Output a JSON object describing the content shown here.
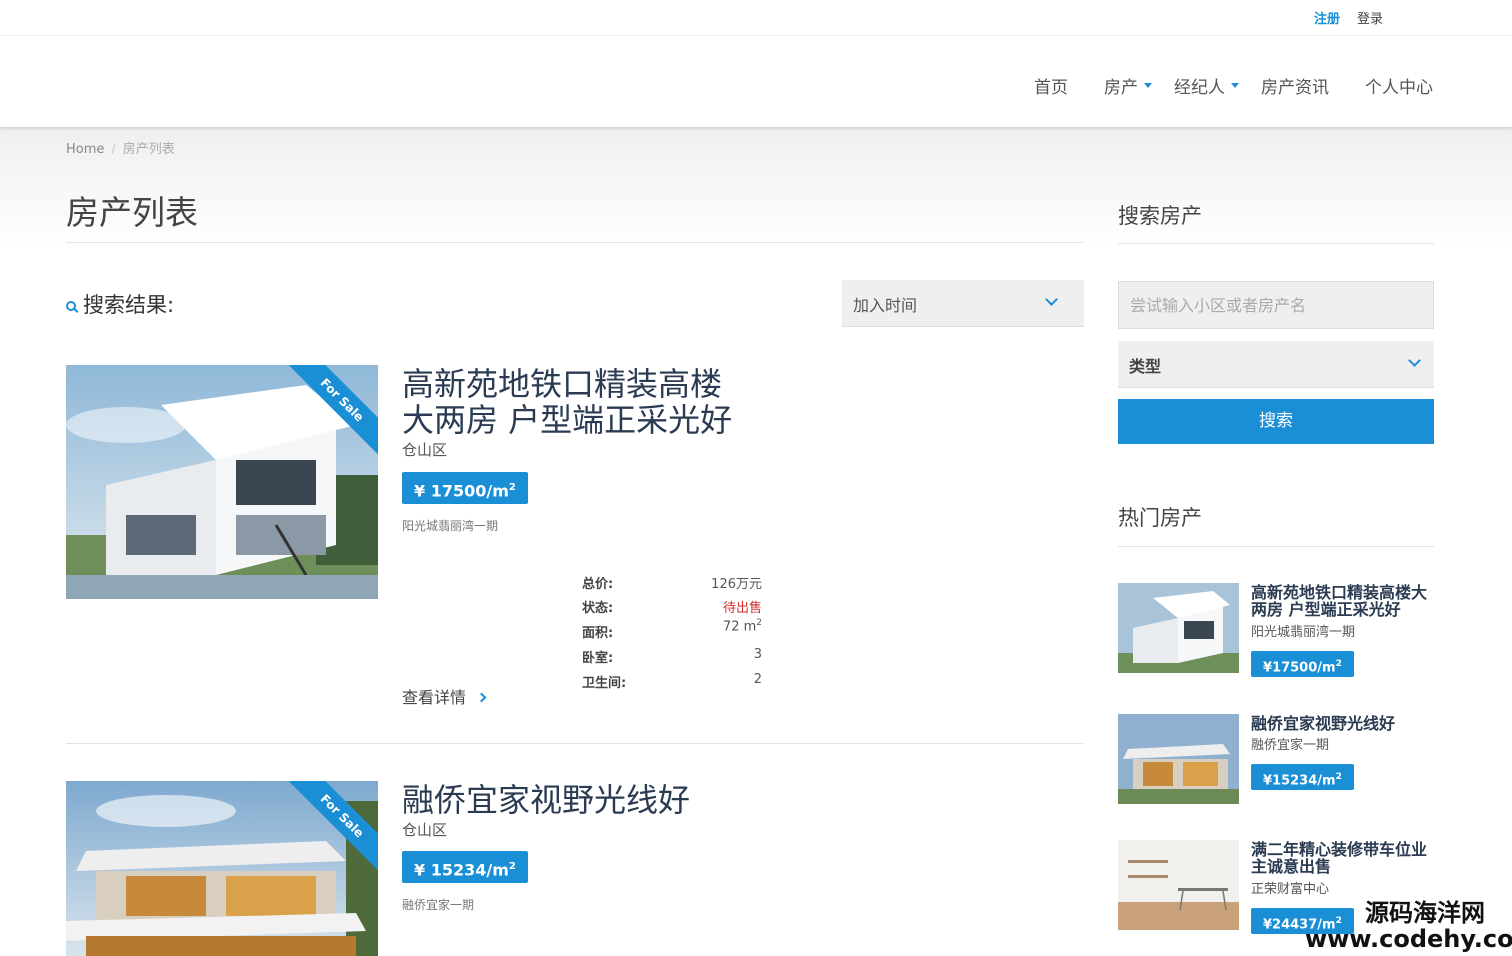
{
  "topbar": {
    "register": "注册",
    "login": "登录"
  },
  "nav": {
    "items": [
      {
        "label": "首页"
      },
      {
        "label": "房产"
      },
      {
        "label": "经纪人"
      },
      {
        "label": "房产资讯"
      },
      {
        "label": "个人中心"
      }
    ]
  },
  "breadcrumb": {
    "home": "Home",
    "current": "房产列表"
  },
  "page": {
    "title": "房产列表"
  },
  "results": {
    "heading": "搜索结果:",
    "sort_label": "加入时间"
  },
  "listings": [
    {
      "ribbon": "For Sale",
      "title_line1": "高新苑地铁口精装高楼",
      "title_line2": "大两房 户型端正采光好",
      "area": "仓山区",
      "price": "¥ 17500/m",
      "price_sup": "2",
      "community": "阳光城翡丽湾一期",
      "specs": [
        {
          "k": "总价:",
          "v": "126万元"
        },
        {
          "k": "状态:",
          "v": "待出售"
        },
        {
          "k": "面积:",
          "v": "72 m",
          "sup": "2"
        },
        {
          "k": "卧室:",
          "v": "3"
        },
        {
          "k": "卫生间:",
          "v": "2"
        }
      ],
      "more": "查看详情"
    },
    {
      "ribbon": "For Sale",
      "title_line1": "融侨宜家视野光线好",
      "area": "仓山区",
      "price": "¥ 15234/m",
      "price_sup": "2",
      "community": "融侨宜家一期"
    }
  ],
  "sidebar": {
    "search_title": "搜索房产",
    "search_placeholder": "尝试输入小区或者房产名",
    "type_label": "类型",
    "search_button": "搜索",
    "hot_title": "热门房产",
    "hot": [
      {
        "title": "高新苑地铁口精装高楼大两房 户型端正采光好",
        "community": "阳光城翡丽湾一期",
        "price": "¥17500/m",
        "sup": "2"
      },
      {
        "title": "融侨宜家视野光线好",
        "community": "融侨宜家一期",
        "price": "¥15234/m",
        "sup": "2"
      },
      {
        "title": "满二年精心装修带车位业主诚意出售",
        "community": "正荣财富中心",
        "price": "¥24437/m",
        "sup": "2"
      }
    ]
  },
  "watermark": {
    "cn": "源码海洋网",
    "url": "www.codehy.com"
  },
  "colors": {
    "accent": "#1a8fd6",
    "title": "#2a3b52",
    "status_red": "#d03030"
  }
}
